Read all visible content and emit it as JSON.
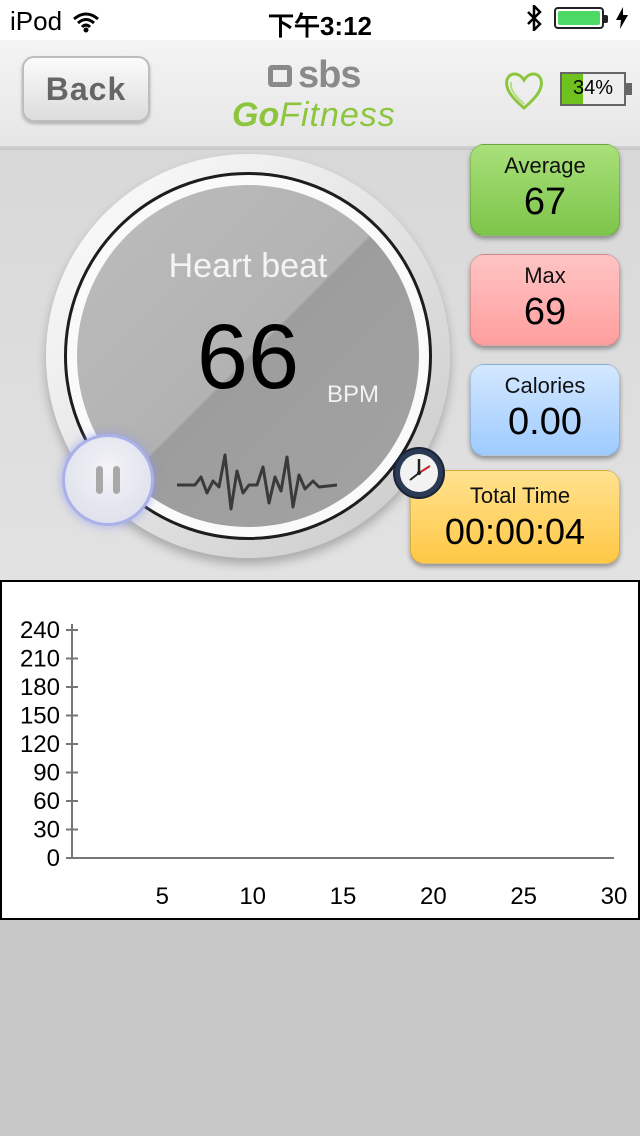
{
  "status_bar": {
    "device": "iPod",
    "time": "下午3:12"
  },
  "header": {
    "back_label": "Back",
    "logo_brand": "sbs",
    "logo_go": "Go",
    "logo_fitness": "Fitness",
    "battery_percent": "34%",
    "battery_level": 0.34
  },
  "dial": {
    "label": "Heart beat",
    "value": "66",
    "unit": "BPM"
  },
  "stats": {
    "average": {
      "label": "Average",
      "value": "67"
    },
    "max": {
      "label": "Max",
      "value": "69"
    },
    "calories": {
      "label": "Calories",
      "value": "0.00"
    },
    "total_time": {
      "label": "Total Time",
      "value": "00:00:04"
    }
  },
  "colors": {
    "accent_green": "#8cc63f",
    "average_card": "#8fd45a",
    "max_card": "#ffaaaa",
    "calories_card": "#b2d6ff",
    "time_card": "#ffd35c"
  },
  "chart_data": {
    "type": "line",
    "x_ticks": [
      "5",
      "10",
      "15",
      "20",
      "25",
      "30"
    ],
    "y_ticks": [
      "0",
      "30",
      "60",
      "90",
      "120",
      "150",
      "180",
      "210",
      "240"
    ],
    "xlim": [
      0,
      30
    ],
    "ylim": [
      0,
      240
    ],
    "series": [],
    "grid": false
  }
}
